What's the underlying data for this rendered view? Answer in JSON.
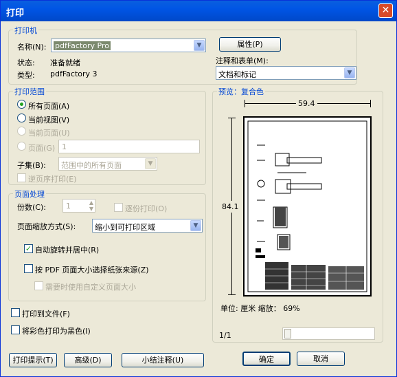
{
  "title": "打印",
  "printer": {
    "group_label": "打印机",
    "name_label": "名称(N):",
    "name_value": "pdfFactory Pro",
    "status_label": "状态:",
    "status_value": "准备就绪",
    "type_label": "类型:",
    "type_value": "pdfFactory 3",
    "properties_button": "属性(P)",
    "comments_label": "注释和表单(M):",
    "comments_value": "文档和标记"
  },
  "range": {
    "group_label": "打印范围",
    "all_pages": "所有页面(A)",
    "current_view": "当前视图(V)",
    "current_page": "当前页面(U)",
    "pages": "页面(G)",
    "pages_value": "1",
    "subset_label": "子集(B):",
    "subset_value": "范围中的所有页面",
    "reverse": "逆页序打印(E)"
  },
  "handling": {
    "group_label": "页面处理",
    "copies_label": "份数(C):",
    "copies_value": "1",
    "collate": "逐份打印(O)",
    "scaling_label": "页面缩放方式(S):",
    "scaling_value": "缩小到可打印区域",
    "auto_rotate": "自动旋转并居中(R)",
    "choose_paper": "按 PDF 页面大小选择纸张来源(Z)",
    "custom_size": "需要时使用自定义页面大小"
  },
  "print_to_file": "打印到文件(F)",
  "print_grayscale": "将彩色打印为黑色(I)",
  "preview": {
    "group_label": "预览：复合色",
    "width": "59.4",
    "height": "84.1",
    "unit_zoom": "单位: 厘米 缩放： 69%",
    "page_indicator": "1/1"
  },
  "buttons": {
    "tips": "打印提示(T)",
    "advanced": "高级(D)",
    "summarize": "小结注释(U)",
    "ok": "确定",
    "cancel": "取消"
  }
}
